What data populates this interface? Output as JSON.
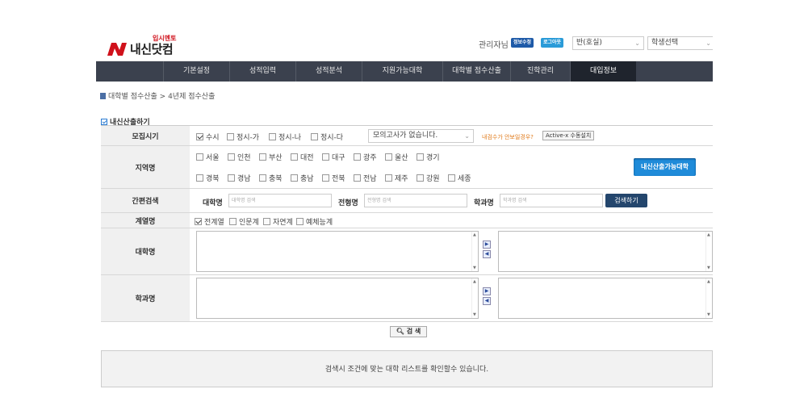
{
  "brand": {
    "tagline": "입시멘토",
    "name": "내신닷컴",
    "accent": "#d0111b"
  },
  "header": {
    "admin_label": "관리자님",
    "info_button": "정보수정",
    "logout_button": "로그아웃",
    "class_select": "반(호실)",
    "student_select": "학생선택"
  },
  "nav": {
    "items": [
      "기본설정",
      "성적입력",
      "성적분석",
      "지원가능대학",
      "대학별 점수산출",
      "진학관리",
      "대입정보"
    ],
    "active_index": 6
  },
  "breadcrumb": "대학별 점수산출 > 4년제 점수산출",
  "section_title": "내신산출하기",
  "form": {
    "recruit": {
      "label": "모집시기",
      "options": [
        {
          "label": "수시",
          "checked": true
        },
        {
          "label": "정시-가",
          "checked": false
        },
        {
          "label": "정시-나",
          "checked": false
        },
        {
          "label": "정시-다",
          "checked": false
        }
      ],
      "mock_select": "모의고사가 없습니다.",
      "hint": "내검수가 안보일경우?",
      "activex_button": "Active-x 수동설치"
    },
    "region": {
      "label": "지역명",
      "row1": [
        "서울",
        "인천",
        "부산",
        "대전",
        "대구",
        "광주",
        "울산",
        "경기"
      ],
      "row2": [
        "경북",
        "경남",
        "충북",
        "충남",
        "전북",
        "전남",
        "제주",
        "강원",
        "세종"
      ],
      "cta_button": "내신산출가능대학"
    },
    "quick": {
      "label": "간편검색",
      "univ_label": "대학명",
      "univ_placeholder": "대학명 검색",
      "type_label": "전형명",
      "type_placeholder": "전형명 검색",
      "dept_label": "학과명",
      "dept_placeholder": "학과명 검색",
      "search_button": "검색하기"
    },
    "track": {
      "label": "계열명",
      "options": [
        {
          "label": "전계열",
          "checked": true
        },
        {
          "label": "인문계",
          "checked": false
        },
        {
          "label": "자연계",
          "checked": false
        },
        {
          "label": "예체능계",
          "checked": false
        }
      ]
    },
    "university": {
      "label": "대학명"
    },
    "department": {
      "label": "학과명"
    }
  },
  "search_button": "검 색",
  "result_message": "검색시 조건에 맞는 대학 리스트를 확인할수 있습니다."
}
